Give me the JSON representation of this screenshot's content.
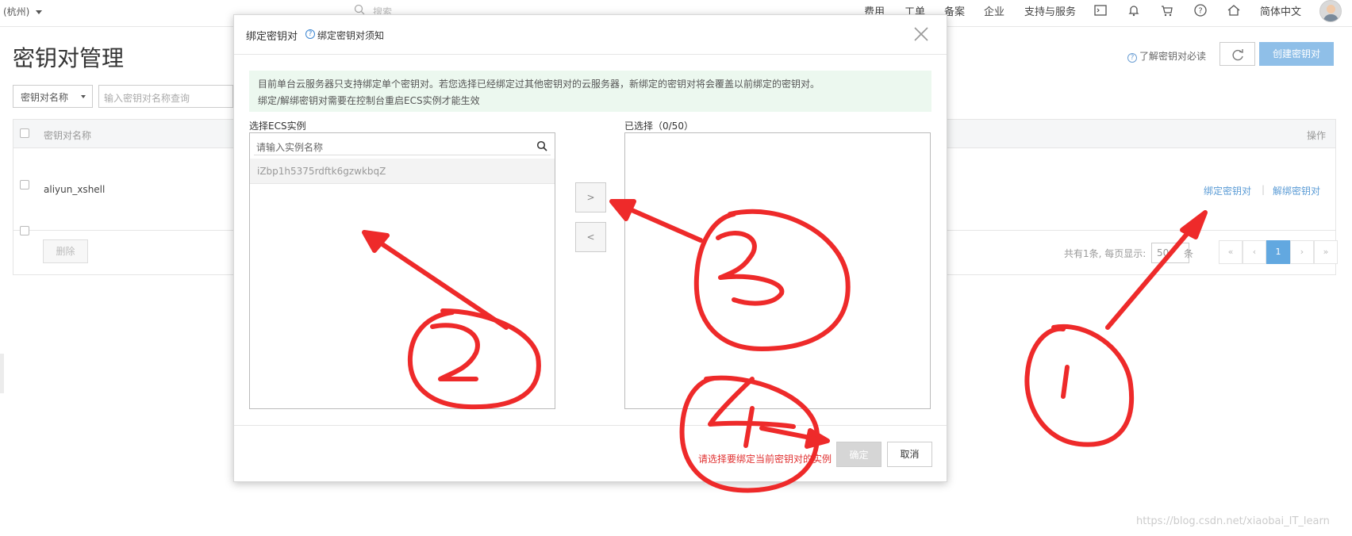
{
  "topbar": {
    "region": "(杭州)",
    "search_placeholder": "搜索",
    "nav": [
      "费用",
      "工单",
      "备案",
      "企业",
      "支持与服务"
    ],
    "language": "简体中文",
    "icons": [
      "terminal-icon",
      "bell-icon",
      "cart-icon",
      "help-icon",
      "home-icon"
    ]
  },
  "page": {
    "title": "密钥对管理",
    "help_link": "了解密钥对必读",
    "create_button": "创建密钥对",
    "filter_select": "密钥对名称",
    "filter_placeholder": "输入密钥对名称查询",
    "table": {
      "headers": [
        "密钥对名称",
        "操作"
      ],
      "rows": [
        {
          "name": "aliyun_xshell",
          "actions": [
            "绑定密钥对",
            "解绑密钥对"
          ]
        }
      ]
    },
    "delete_button": "删除",
    "pager": {
      "summary": "共有1条, 每页显示:",
      "page_size": "50",
      "unit": "条",
      "buttons": [
        "«",
        "‹",
        "1",
        "›",
        "»"
      ],
      "current": "1"
    }
  },
  "modal": {
    "title": "绑定密钥对",
    "notice_link": "绑定密钥对须知",
    "info_lines": [
      "目前单台云服务器只支持绑定单个密钥对。若您选择已经绑定过其他密钥对的云服务器，新绑定的密钥对将会覆盖以前绑定的密钥对。",
      "绑定/解绑密钥对需要在控制台重启ECS实例才能生效"
    ],
    "left_panel": {
      "label": "选择ECS实例",
      "search_placeholder": "请输入实例名称",
      "items": [
        "iZbp1h5375rdftk6gzwkbqZ"
      ]
    },
    "right_panel": {
      "label": "已选择（0/50）"
    },
    "move_right": ">",
    "move_left": "<",
    "footer_message": "请选择要绑定当前密钥对的实例",
    "ok_button": "确定",
    "cancel_button": "取消"
  },
  "watermark": "https://blog.csdn.net/xiaobai_IT_learn",
  "colors": {
    "link_blue": "#5a9bd5",
    "primary_disabled": "#8fbfe8",
    "info_bg": "#ecf8ef",
    "error_red": "#e03030",
    "annotation_red": "#ee2a2a"
  }
}
